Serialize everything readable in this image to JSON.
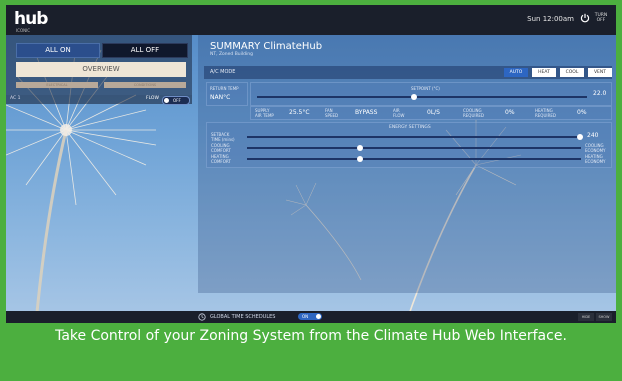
{
  "topbar": {
    "logo": "hub",
    "logo_sub": "ICONIC",
    "clock": "Sun 12:00am",
    "power_label": "TURN OFF"
  },
  "left": {
    "all_on": "ALL ON",
    "all_off": "ALL OFF",
    "overview": "OVERVIEW",
    "small_btn_1": "ELECTRICAL",
    "small_btn_2": "CONDITIONS",
    "zone_label": "AC 1",
    "flow_label": "FLOW",
    "toggle_label": "OFF"
  },
  "main": {
    "title": "SUMMARY ClimateHub",
    "subtitle": "NT, Zoned Building",
    "mode_label": "A/C MODE",
    "mode_buttons": [
      "AUTO",
      "HEAT",
      "COOL",
      "VENT"
    ],
    "return_temp_label": "RETURN TEMP",
    "return_temp_value": "NAN°C",
    "setpoint_label": "SETPOINT (°C)",
    "setpoint_value": "22.0",
    "supply_label": "SUPPLY AIR TEMP",
    "supply_value": "25.5°C",
    "fan_label": "FAN SPEED",
    "fan_value": "BYPASS",
    "air_label": "AIR FLOW",
    "air_value": "0L/S",
    "cool_req_label": "COOLING REQUIRED",
    "cool_req_value": "0%",
    "heat_req_label": "HEATING REQUIRED",
    "heat_req_value": "0%",
    "energy_title": "ENERGY SETTINGS",
    "setback_label": "SETBACK TIME (mins)",
    "setback_value": "240",
    "cooling_comfort_label": "COOLING COMFORT",
    "cooling_economy_label": "COOLING ECONOMY",
    "heating_comfort_label": "HEATING COMFORT",
    "heating_economy_label": "HEATING ECONOMY"
  },
  "bottom": {
    "schedules_label": "GLOBAL TIME SCHEDULES",
    "schedules_toggle": "ON",
    "right_btn_1": "HIDE",
    "right_btn_2": "SHOW"
  },
  "caption": "Take Control of your Zoning System from the Climate Hub Web Interface.",
  "colors": {
    "frame_green": "#4caf3f",
    "topbar": "#1a1f2b",
    "sky": "#6da2d6",
    "accent": "#2b4e8c"
  }
}
